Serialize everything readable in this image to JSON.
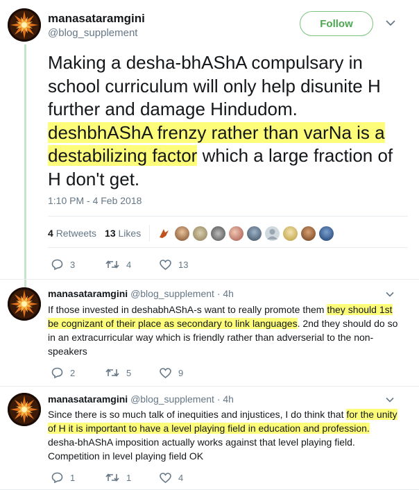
{
  "main_tweet": {
    "display_name": "manasataramgini",
    "handle": "@blog_supplement",
    "follow_label": "Follow",
    "text": {
      "p1": "Making a desha-bhAShA compulsary in school curriculum will only help disunite H further and damage Hindudom. ",
      "hl": "deshbhAShA frenzy rather than varNa is a destabilizing factor",
      "p2": " which a large fraction of H don't get."
    },
    "timestamp": "1:10 PM - 4 Feb 2018",
    "retweets_count": "4",
    "retweets_label": "Retweets",
    "likes_count": "13",
    "likes_label": "Likes",
    "actions": {
      "replies": "3",
      "retweets": "4",
      "likes": "13"
    }
  },
  "replies": [
    {
      "display_name": "manasataramgini",
      "handle": "@blog_supplement",
      "time": "· 4h",
      "text_p1": "If those invested in deshabhAShA-s want to really promote them ",
      "text_hl": "they should 1st be cognizant of their place as secondary to link languages",
      "text_p2": ". 2nd they should do so in an extracurricular way which is friendly rather than adverserial to the non-speakers",
      "actions": {
        "replies": "2",
        "retweets": "5",
        "likes": "9"
      }
    },
    {
      "display_name": "manasataramgini",
      "handle": "@blog_supplement",
      "time": "· 4h",
      "text_p1": "Since there is so much talk of inequities and injustices, I do think that ",
      "text_hl": "for the unity of H it is important to have a level playing field in education and profession.",
      "text_p2": " desha-bhAShA imposition actually works against that level playing field. Competition in level playing field OK",
      "actions": {
        "replies": "1",
        "retweets": "1",
        "likes": "4"
      }
    }
  ],
  "icons": {
    "reply": "reply-icon",
    "retweet": "retweet-icon",
    "like": "heart-icon",
    "more": "chevron-down-icon"
  },
  "colors": {
    "follow_green": "#4aa64f",
    "highlight": "#fdfd7a",
    "thread_line": "#c4e5c9",
    "muted": "#657786"
  }
}
